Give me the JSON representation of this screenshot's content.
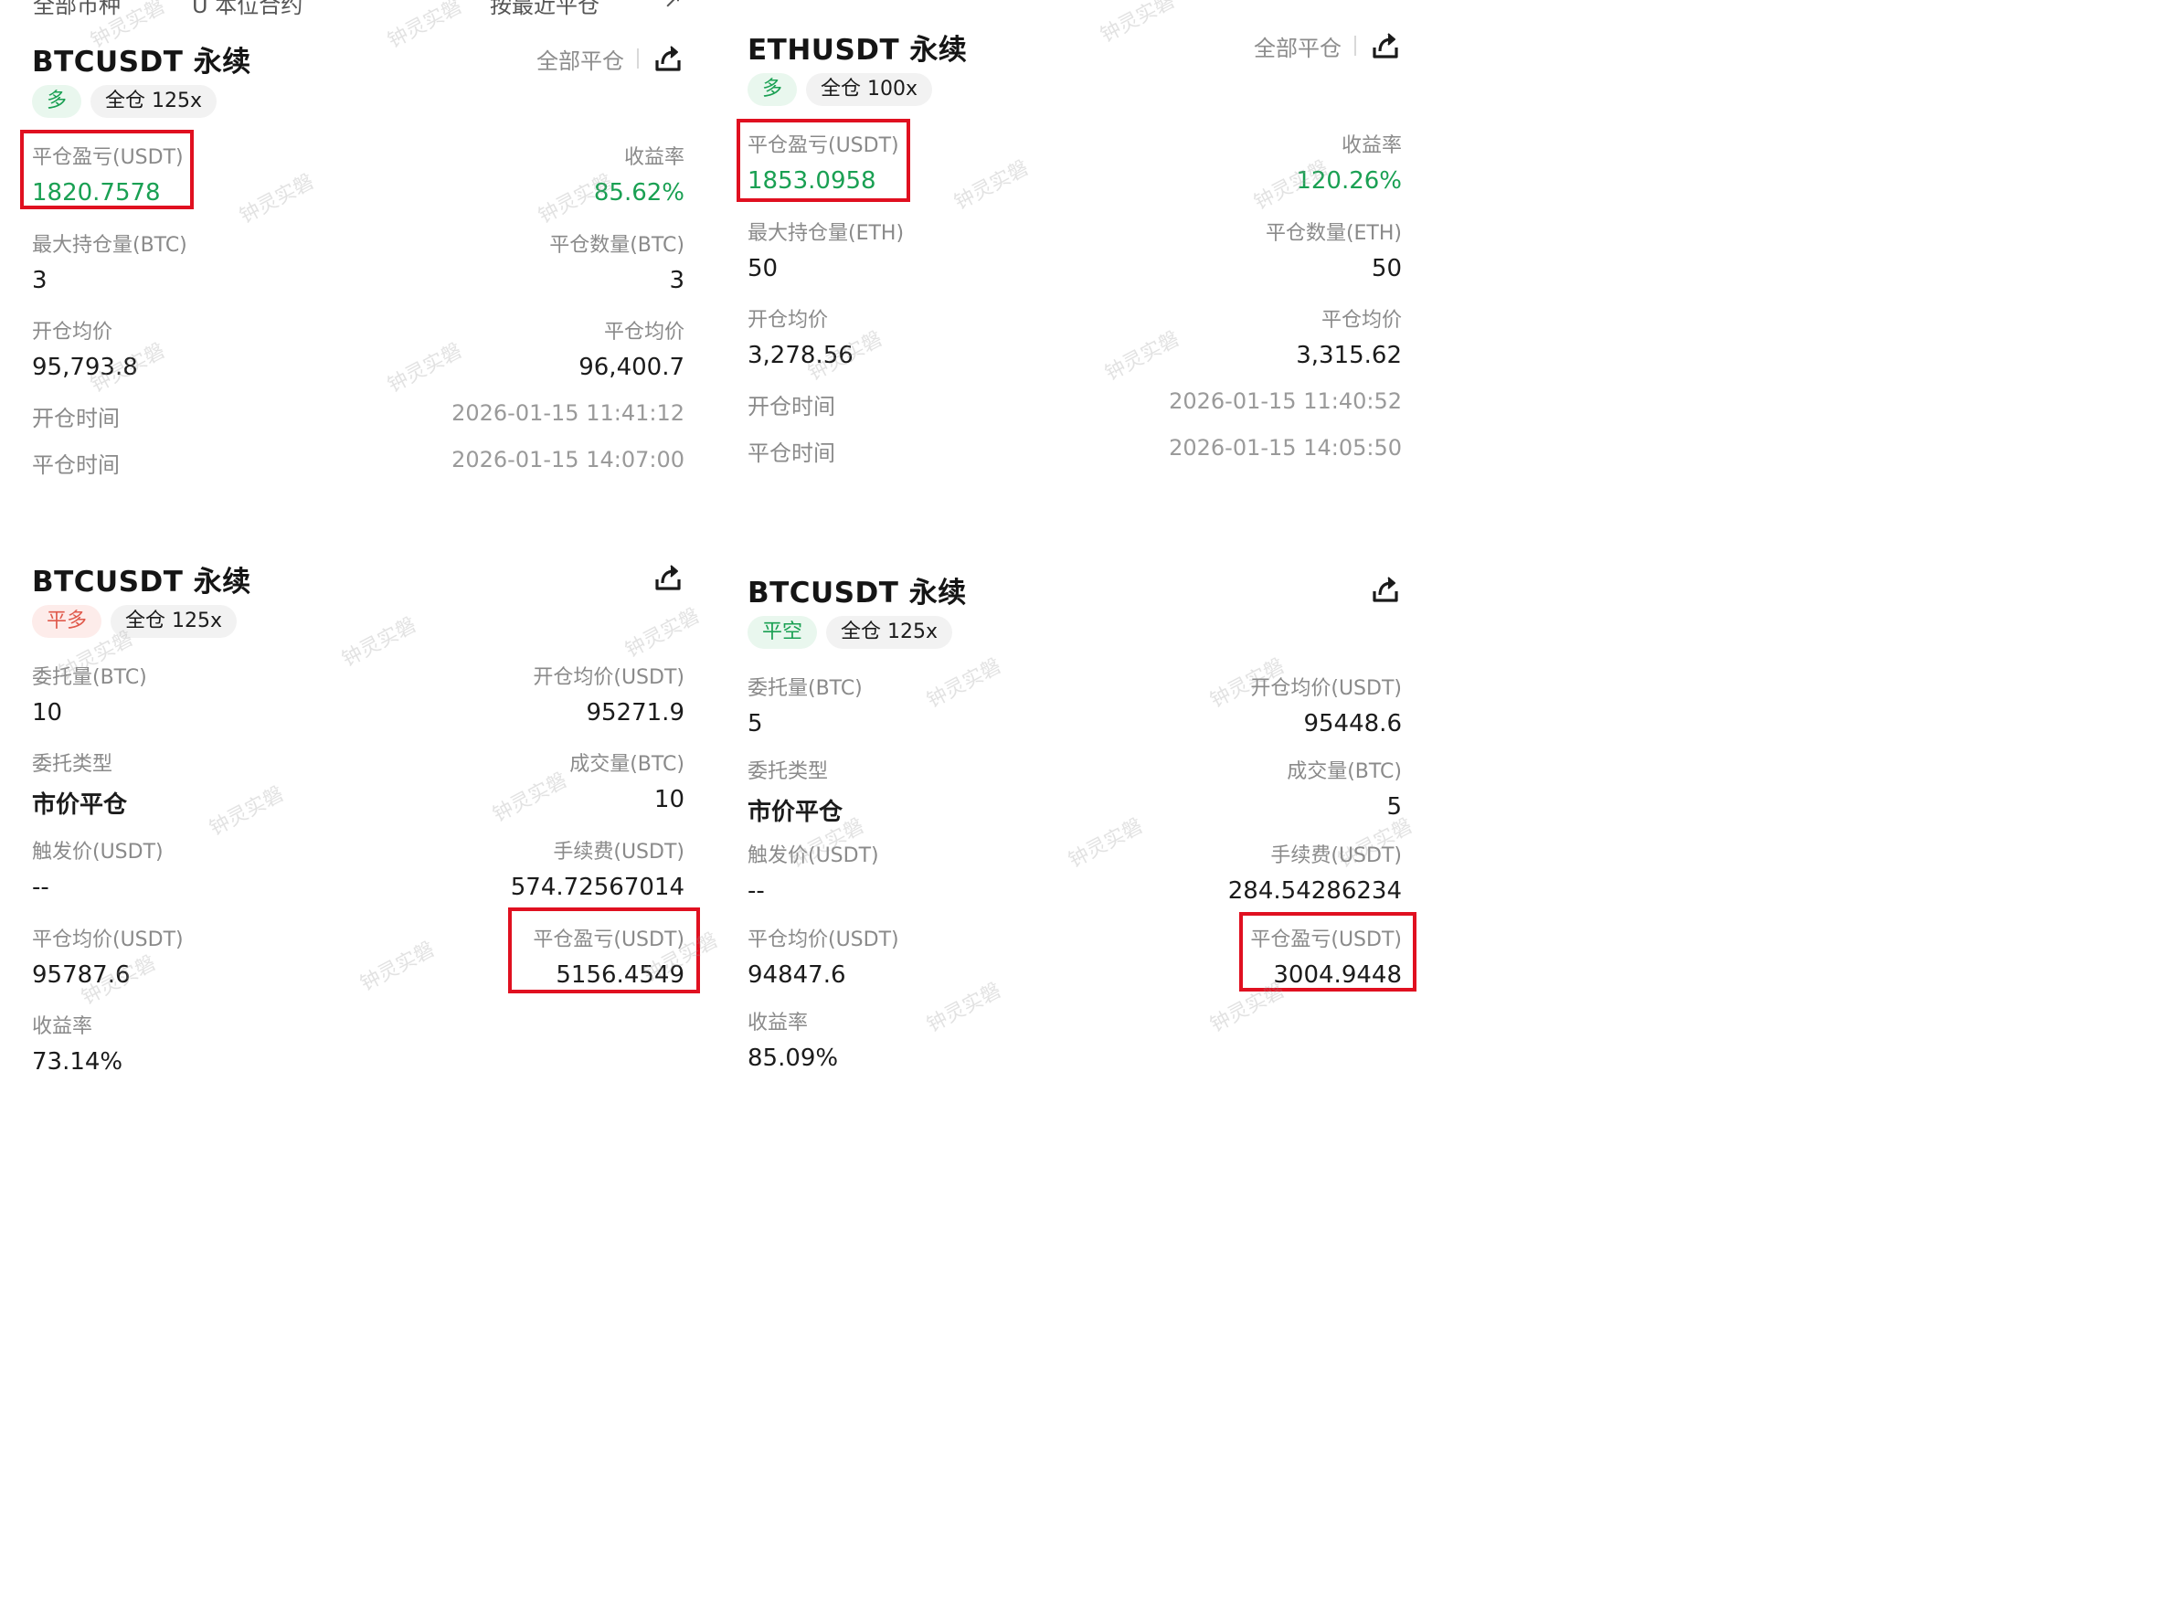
{
  "top_strip": [
    "全部市种",
    "U 本位合约",
    "按最近平仓",
    "↗"
  ],
  "watermark": "钟灵实磐",
  "cards": [
    {
      "title": "BTCUSDT 永续",
      "close_all": "全部平仓",
      "tags": [
        "多",
        "全仓 125x"
      ],
      "pnl_label": "平仓盈亏(USDT)",
      "pnl_value": "1820.7578",
      "roi_label": "收益率",
      "roi_value": "85.62%",
      "max_pos_label": "最大持仓量(BTC)",
      "max_pos_value": "3",
      "close_qty_label": "平仓数量(BTC)",
      "close_qty_value": "3",
      "open_avg_label": "开仓均价",
      "open_avg_value": "95,793.8",
      "close_avg_label": "平仓均价",
      "close_avg_value": "96,400.7",
      "open_time_label": "开仓时间",
      "open_time_value": "2026-01-15 11:41:12",
      "close_time_label": "平仓时间",
      "close_time_value": "2026-01-15 14:07:00"
    },
    {
      "title": "ETHUSDT 永续",
      "close_all": "全部平仓",
      "tags": [
        "多",
        "全仓 100x"
      ],
      "pnl_label": "平仓盈亏(USDT)",
      "pnl_value": "1853.0958",
      "roi_label": "收益率",
      "roi_value": "120.26%",
      "max_pos_label": "最大持仓量(ETH)",
      "max_pos_value": "50",
      "close_qty_label": "平仓数量(ETH)",
      "close_qty_value": "50",
      "open_avg_label": "开仓均价",
      "open_avg_value": "3,278.56",
      "close_avg_label": "平仓均价",
      "close_avg_value": "3,315.62",
      "open_time_label": "开仓时间",
      "open_time_value": "2026-01-15 11:40:52",
      "close_time_label": "平仓时间",
      "close_time_value": "2026-01-15 14:05:50"
    },
    {
      "title": "BTCUSDT 永续",
      "tags": [
        "平多",
        "全仓 125x"
      ],
      "order_qty_label": "委托量(BTC)",
      "order_qty_value": "10",
      "open_avg_label": "开仓均价(USDT)",
      "open_avg_value": "95271.9",
      "order_type_label": "委托类型",
      "order_type_value": "市价平仓",
      "filled_label": "成交量(BTC)",
      "filled_value": "10",
      "trigger_label": "触发价(USDT)",
      "trigger_value": "--",
      "fee_label": "手续费(USDT)",
      "fee_value": "574.72567014",
      "close_avg_label": "平仓均价(USDT)",
      "close_avg_value": "95787.6",
      "pnl_label": "平仓盈亏(USDT)",
      "pnl_value": "5156.4549",
      "roi_label": "收益率",
      "roi_value": "73.14%"
    },
    {
      "title": "BTCUSDT 永续",
      "tags": [
        "平空",
        "全仓 125x"
      ],
      "order_qty_label": "委托量(BTC)",
      "order_qty_value": "5",
      "open_avg_label": "开仓均价(USDT)",
      "open_avg_value": "95448.6",
      "order_type_label": "委托类型",
      "order_type_value": "市价平仓",
      "filled_label": "成交量(BTC)",
      "filled_value": "5",
      "trigger_label": "触发价(USDT)",
      "trigger_value": "--",
      "fee_label": "手续费(USDT)",
      "fee_value": "284.54286234",
      "close_avg_label": "平仓均价(USDT)",
      "close_avg_value": "94847.6",
      "pnl_label": "平仓盈亏(USDT)",
      "pnl_value": "3004.9448",
      "roi_label": "收益率",
      "roi_value": "85.09%"
    }
  ]
}
